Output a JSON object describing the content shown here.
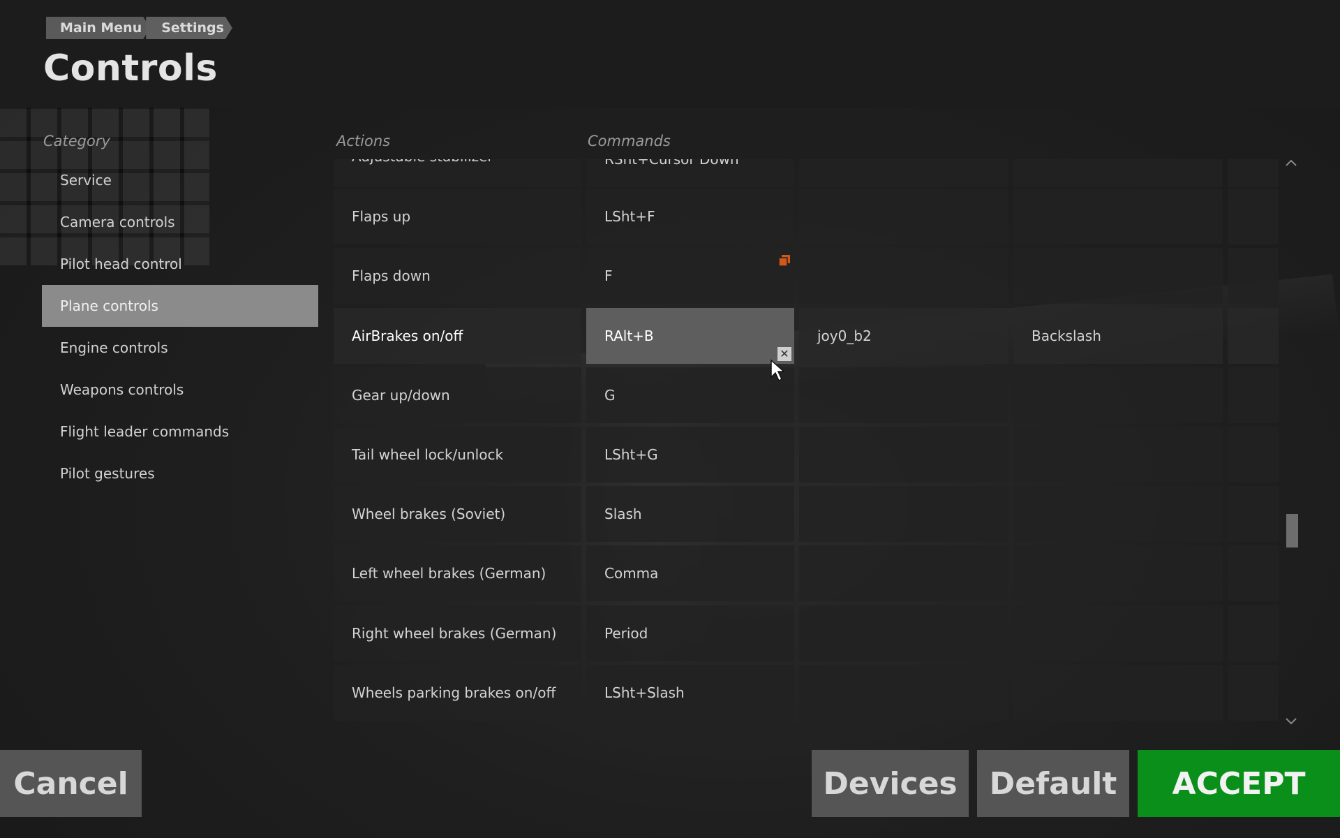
{
  "breadcrumb": [
    "Main Menu",
    "Settings"
  ],
  "page_title": "Controls",
  "category_header": "Category",
  "categories": [
    {
      "label": "Service",
      "active": false
    },
    {
      "label": "Camera controls",
      "active": false
    },
    {
      "label": "Pilot head control",
      "active": false
    },
    {
      "label": "Plane controls",
      "active": true
    },
    {
      "label": "Engine controls",
      "active": false
    },
    {
      "label": "Weapons controls",
      "active": false
    },
    {
      "label": "Flight leader commands",
      "active": false
    },
    {
      "label": "Pilot gestures",
      "active": false
    }
  ],
  "columns": {
    "actions": "Actions",
    "commands": "Commands"
  },
  "rows": [
    {
      "action": "Adjustable stabilizer",
      "cmd1": "RSht+Cursor Down",
      "cmd2": "",
      "cmd3": ""
    },
    {
      "action": "Flaps up",
      "cmd1": "LSht+F",
      "cmd2": "",
      "cmd3": ""
    },
    {
      "action": "Flaps down",
      "cmd1": "F",
      "cmd2": "",
      "cmd3": ""
    },
    {
      "action": "AirBrakes on/off",
      "cmd1": "RAlt+B",
      "cmd2": "joy0_b2",
      "cmd3": "Backslash"
    },
    {
      "action": "Gear up/down",
      "cmd1": "G",
      "cmd2": "",
      "cmd3": ""
    },
    {
      "action": "Tail wheel lock/unlock",
      "cmd1": "LSht+G",
      "cmd2": "",
      "cmd3": ""
    },
    {
      "action": "Wheel brakes (Soviet)",
      "cmd1": "Slash",
      "cmd2": "",
      "cmd3": ""
    },
    {
      "action": "Left wheel brakes (German)",
      "cmd1": "Comma",
      "cmd2": "",
      "cmd3": ""
    },
    {
      "action": "Right wheel brakes (German)",
      "cmd1": "Period",
      "cmd2": "",
      "cmd3": ""
    },
    {
      "action": "Wheels parking brakes on/off",
      "cmd1": "LSht+Slash",
      "cmd2": "",
      "cmd3": ""
    }
  ],
  "buttons": {
    "cancel": "Cancel",
    "devices": "Devices",
    "default": "Default",
    "accept": "ACCEPT"
  },
  "colors": {
    "accept_green": "#0a8f1a",
    "copy_icon_orange": "#d2571a",
    "active_category": "#8b8b8b"
  }
}
